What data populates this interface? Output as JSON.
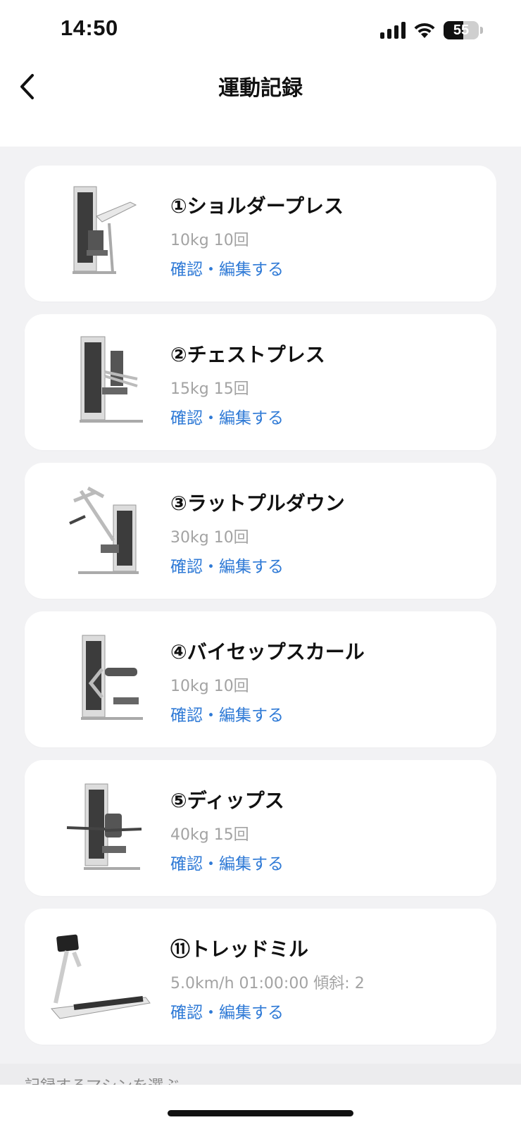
{
  "status_bar": {
    "time": "14:50",
    "battery_level": "55",
    "battery_fraction": 0.55
  },
  "nav": {
    "title": "運動記録",
    "back_icon": "chevron-left-icon"
  },
  "records": [
    {
      "title": "①ショルダープレス",
      "detail": "10kg 10回",
      "action": "確認・編集する",
      "icon": "shoulder-press-machine"
    },
    {
      "title": "②チェストプレス",
      "detail": "15kg 15回",
      "action": "確認・編集する",
      "icon": "chest-press-machine"
    },
    {
      "title": "③ラットプルダウン",
      "detail": "30kg 10回",
      "action": "確認・編集する",
      "icon": "lat-pulldown-machine"
    },
    {
      "title": "④バイセップスカール",
      "detail": "10kg 10回",
      "action": "確認・編集する",
      "icon": "biceps-curl-machine"
    },
    {
      "title": "⑤ディップス",
      "detail": "40kg 15回",
      "action": "確認・編集する",
      "icon": "dips-machine"
    },
    {
      "title": "⑪トレッドミル",
      "detail": "5.0km/h 01:00:00 傾斜: 2",
      "action": "確認・編集する",
      "icon": "treadmill"
    }
  ],
  "section": {
    "label": "記録するマシンを選ぶ"
  },
  "colors": {
    "link": "#2f7ad6",
    "detail": "#a3a3a3",
    "background": "#f2f2f4"
  }
}
